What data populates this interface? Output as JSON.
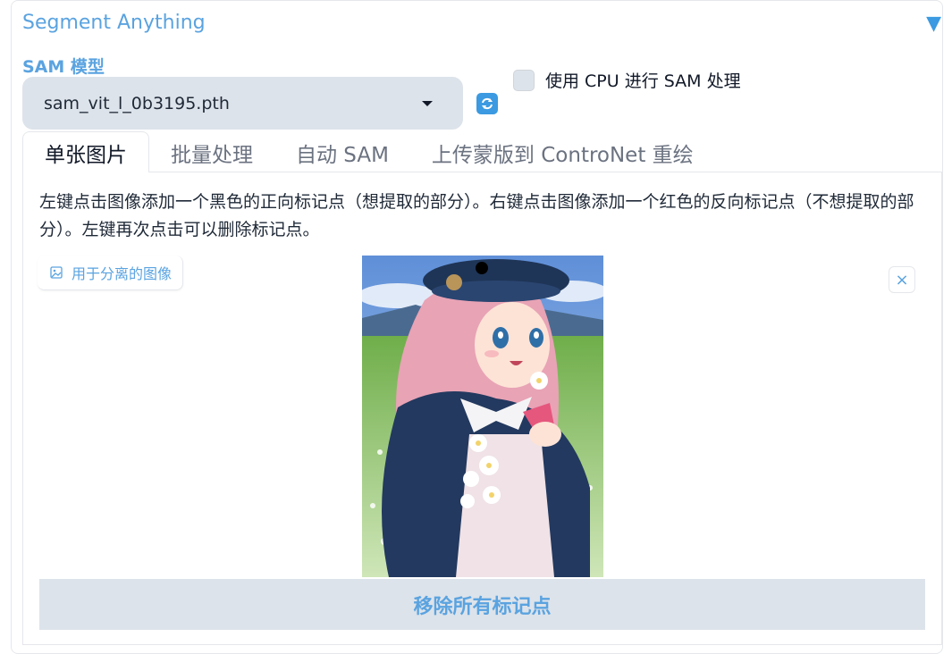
{
  "accordion": {
    "title": "Segment Anything",
    "toggle_icon": "▼"
  },
  "sam_model": {
    "label": "SAM 模型",
    "selected": "sam_vit_l_0b3195.pth"
  },
  "cpu_option": {
    "label": "使用 CPU 进行 SAM 处理",
    "checked": false
  },
  "tabs": [
    {
      "label": "单张图片",
      "active": true
    },
    {
      "label": "批量处理",
      "active": false
    },
    {
      "label": "自动 SAM",
      "active": false
    },
    {
      "label": "上传蒙版到 ControNet 重绘",
      "active": false
    }
  ],
  "single_image": {
    "instructions": "左键点击图像添加一个黑色的正向标记点（想提取的部分）。右键点击图像添加一个红色的反向标记点（不想提取的部分）。左键再次点击可以删除标记点。",
    "image_label": "用于分离的图像",
    "clear_icon": "×",
    "remove_points_label": "移除所有标记点"
  },
  "colors": {
    "accent": "#5aa3e0",
    "control_bg": "#dde3ea",
    "border": "#e5e7eb"
  }
}
